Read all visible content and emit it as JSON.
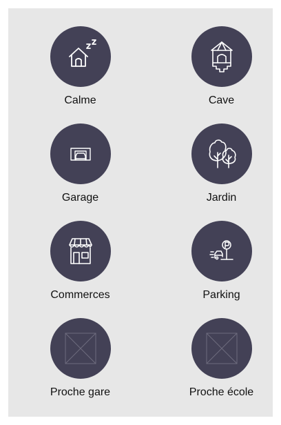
{
  "colors": {
    "panel_background": "#e7e7e7",
    "circle_fill": "#434156",
    "icon_stroke": "#ffffff",
    "placeholder_stroke": "#6e6c7e",
    "label_text": "#111111"
  },
  "amenities": [
    {
      "label": "Calme",
      "icon": "house-sleeping-icon"
    },
    {
      "label": "Cave",
      "icon": "cellar-icon"
    },
    {
      "label": "Garage",
      "icon": "garage-icon"
    },
    {
      "label": "Jardin",
      "icon": "trees-icon"
    },
    {
      "label": "Commerces",
      "icon": "shop-icon"
    },
    {
      "label": "Parking",
      "icon": "parking-icon"
    },
    {
      "label": "Proche gare",
      "icon": "placeholder-image-icon"
    },
    {
      "label": "Proche école",
      "icon": "placeholder-image-icon"
    }
  ]
}
